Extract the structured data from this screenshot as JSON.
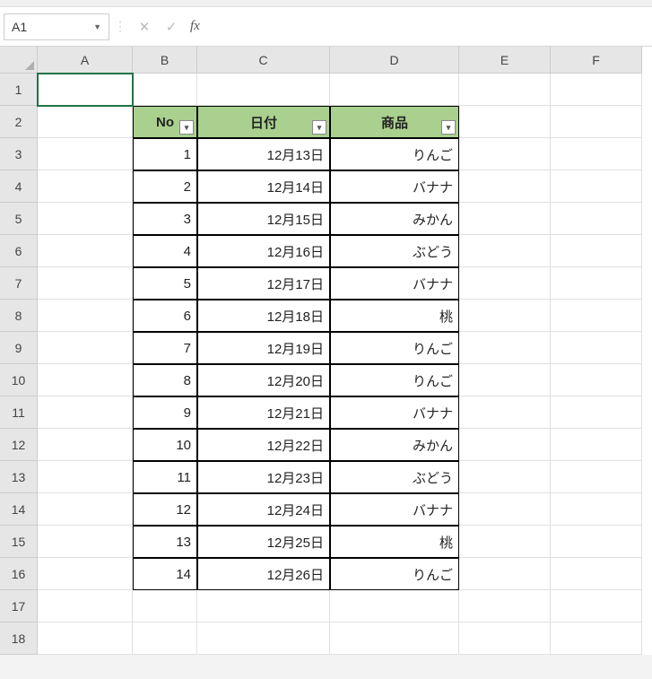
{
  "formula_bar": {
    "name_box": "A1",
    "cancel": "✕",
    "confirm": "✓",
    "fx": "fx",
    "formula_value": ""
  },
  "columns": [
    "A",
    "B",
    "C",
    "D",
    "E",
    "F"
  ],
  "row_numbers": [
    "1",
    "2",
    "3",
    "4",
    "5",
    "6",
    "7",
    "8",
    "9",
    "10",
    "11",
    "12",
    "13",
    "14",
    "15",
    "16",
    "17",
    "18"
  ],
  "table": {
    "headers": {
      "no": "No",
      "date": "日付",
      "product": "商品"
    },
    "rows": [
      {
        "no": "1",
        "date": "12月13日",
        "product": "りんご"
      },
      {
        "no": "2",
        "date": "12月14日",
        "product": "バナナ"
      },
      {
        "no": "3",
        "date": "12月15日",
        "product": "みかん"
      },
      {
        "no": "4",
        "date": "12月16日",
        "product": "ぶどう"
      },
      {
        "no": "5",
        "date": "12月17日",
        "product": "バナナ"
      },
      {
        "no": "6",
        "date": "12月18日",
        "product": "桃"
      },
      {
        "no": "7",
        "date": "12月19日",
        "product": "りんご"
      },
      {
        "no": "8",
        "date": "12月20日",
        "product": "りんご"
      },
      {
        "no": "9",
        "date": "12月21日",
        "product": "バナナ"
      },
      {
        "no": "10",
        "date": "12月22日",
        "product": "みかん"
      },
      {
        "no": "11",
        "date": "12月23日",
        "product": "ぶどう"
      },
      {
        "no": "12",
        "date": "12月24日",
        "product": "バナナ"
      },
      {
        "no": "13",
        "date": "12月25日",
        "product": "桃"
      },
      {
        "no": "14",
        "date": "12月26日",
        "product": "りんご"
      }
    ]
  },
  "filter_glyph": "▾"
}
